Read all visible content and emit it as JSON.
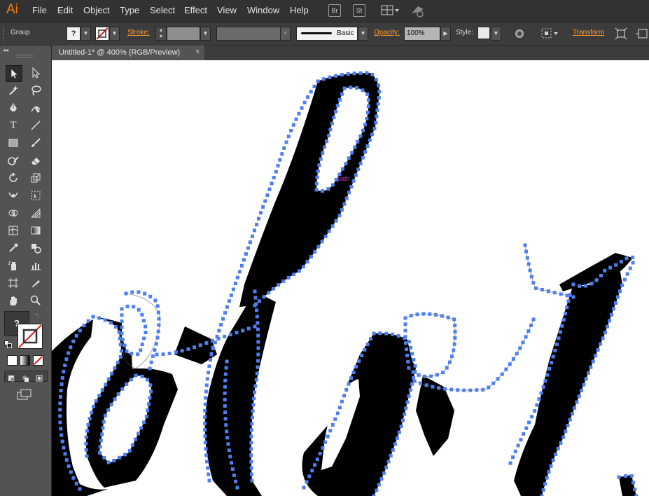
{
  "app": {
    "logo": "Ai",
    "brand_color": "#ff7c00"
  },
  "menu": [
    "File",
    "Edit",
    "Object",
    "Type",
    "Select",
    "Effect",
    "View",
    "Window",
    "Help"
  ],
  "menubar_icons": {
    "bridge": "Br",
    "stock": "St"
  },
  "control_bar": {
    "selection_type": "Group",
    "fill_value": "?",
    "stroke_label": "Stroke:",
    "brush_label": "Basic",
    "opacity_label": "Opacity:",
    "opacity_value": "100%",
    "style_label": "Style:",
    "transform_label": "Transform",
    "link_color": "#ff9a2e"
  },
  "document_tab": {
    "title": "Untitled-1* @ 400% (RGB/Preview)",
    "close": "×"
  },
  "canvas": {
    "hover_label": "path",
    "anchor_color": "#4e7ff0",
    "hover_label_color": "#c43cc8"
  },
  "tools": {
    "unknown_color_label": "?"
  }
}
